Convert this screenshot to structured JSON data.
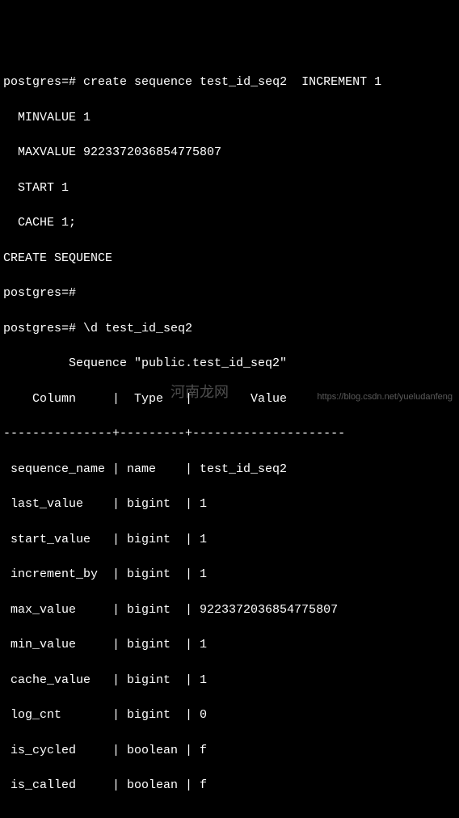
{
  "prompt": "postgres=#",
  "cmd": {
    "create_seq": "create sequence test_id_seq2  INCREMENT 1",
    "minvalue": "  MINVALUE 1",
    "maxvalue": "  MAXVALUE 9223372036854775807",
    "start": "  START 1",
    "cache": "  CACHE 1;",
    "response": "CREATE SEQUENCE",
    "describe": "\\d test_id_seq2"
  },
  "header": {
    "title": "         Sequence \"public.test_id_seq2\"",
    "columns": "    Column     |  Type   |        Value        ",
    "separator": "---------------+---------+---------------------"
  },
  "rows": {
    "r0": " sequence_name | name    | test_id_seq2",
    "r1": " last_value    | bigint  | 1",
    "r2": " start_value   | bigint  | 1",
    "r3": " increment_by  | bigint  | 1",
    "r4": " max_value     | bigint  | 9223372036854775807",
    "r5": " min_value     | bigint  | 1",
    "r6": " cache_value   | bigint  | 1",
    "r7": " log_cnt       | bigint  | 0",
    "r8": " is_cycled     | boolean | f",
    "r9": " is_called     | boolean | f"
  },
  "watermark_url": "https://blog.csdn.net/yueludanfeng",
  "watermark_cn": "河南龙网"
}
